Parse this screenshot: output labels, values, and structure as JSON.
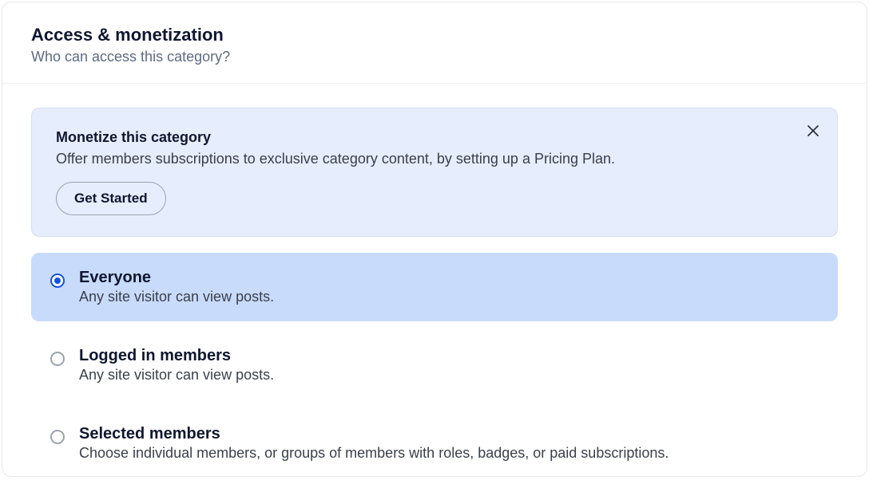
{
  "header": {
    "title": "Access & monetization",
    "subtitle": "Who can access this category?"
  },
  "banner": {
    "title": "Monetize this category",
    "description": "Offer members subscriptions to exclusive category content, by setting up a Pricing Plan.",
    "cta": "Get Started"
  },
  "options": [
    {
      "title": "Everyone",
      "description": "Any site visitor can view posts.",
      "selected": true
    },
    {
      "title": "Logged in members",
      "description": "Any site visitor can view posts.",
      "selected": false
    },
    {
      "title": "Selected members",
      "description": "Choose individual members, or groups of members with roles, badges, or paid subscriptions.",
      "selected": false
    }
  ]
}
